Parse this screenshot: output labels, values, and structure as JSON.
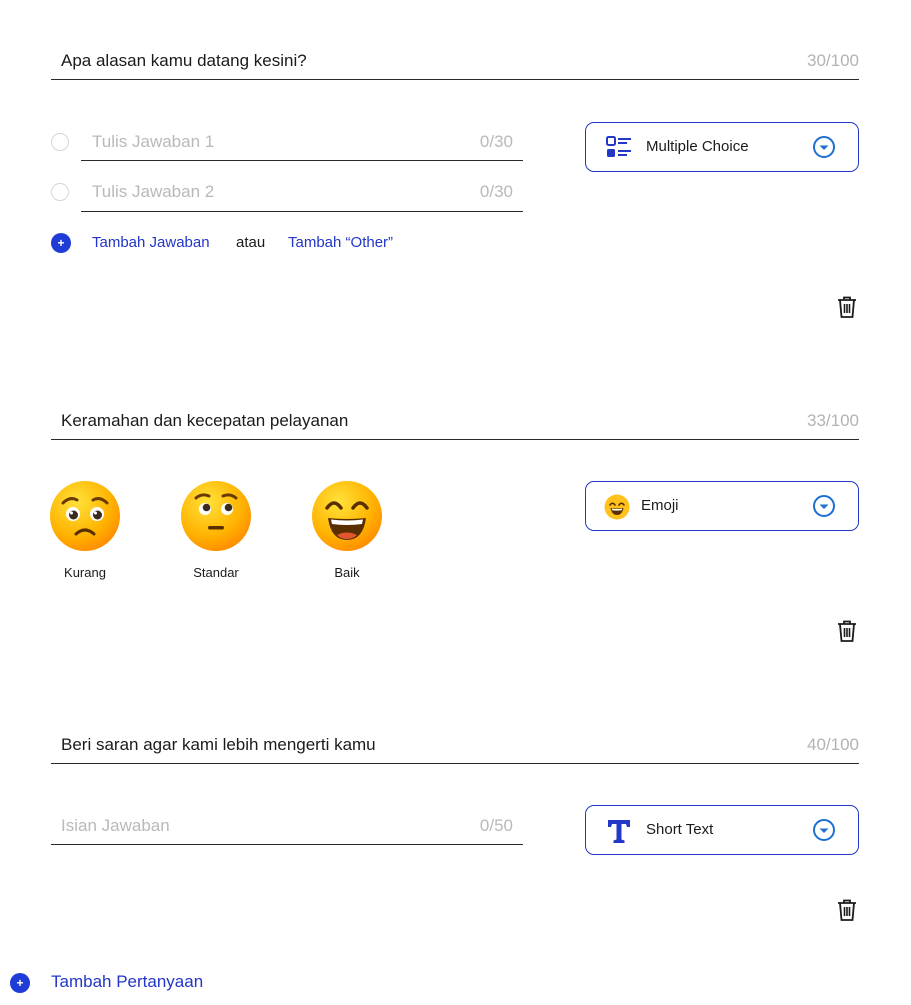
{
  "questions": [
    {
      "title": "Apa alasan kamu datang kesini?",
      "count": "30/100",
      "type_label": "Multiple Choice",
      "answers": [
        {
          "placeholder": "Tulis Jawaban 1",
          "count": "0/30"
        },
        {
          "placeholder": "Tulis Jawaban 2",
          "count": "0/30"
        }
      ],
      "add_answer": "Tambah Jawaban",
      "or_text": "atau",
      "add_other": "Tambah “Other”"
    },
    {
      "title": "Keramahan dan kecepatan pelayanan",
      "count": "33/100",
      "type_label": "Emoji",
      "emojis": [
        {
          "label": "Kurang"
        },
        {
          "label": "Standar"
        },
        {
          "label": "Baik"
        }
      ]
    },
    {
      "title": "Beri saran agar kami lebih mengerti kamu",
      "count": "40/100",
      "type_label": "Short Text",
      "answer_placeholder": "Isian Jawaban",
      "answer_count": "0/50"
    }
  ],
  "add_question": "Tambah Pertanyaan",
  "colors": {
    "accent": "#2438c7",
    "chevron": "#1e6fd0",
    "emoji_yellow": "#ffc21c",
    "emoji_orange": "#ff9d0a"
  },
  "icons": [
    "multiple-choice-icon",
    "emoji-icon",
    "text-icon",
    "chevron-down-icon",
    "trash-icon",
    "plus-icon"
  ]
}
